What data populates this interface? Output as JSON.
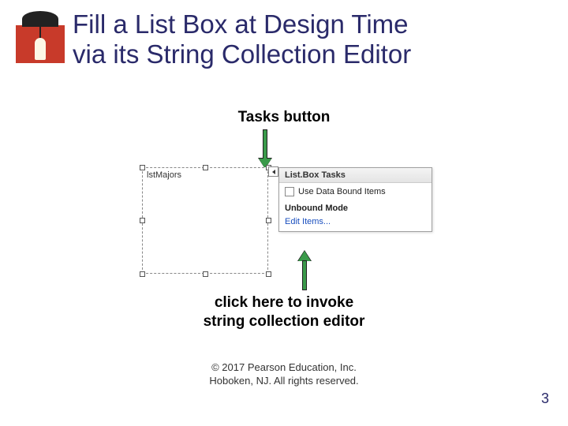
{
  "title_line1": "Fill a List Box at Design Time",
  "title_line2": "via its String Collection Editor",
  "annotation_top": "Tasks button",
  "listbox_name": "lstMajors",
  "tasks_panel": {
    "title": "List.Box Tasks",
    "checkbox_label": "Use Data Bound Items",
    "section": "Unbound Mode",
    "link": "Edit Items..."
  },
  "annotation_bottom_line1": "click here to invoke",
  "annotation_bottom_line2": "string collection editor",
  "copyright_line1": "© 2017 Pearson Education, Inc.",
  "copyright_line2": "Hoboken, NJ. All rights reserved.",
  "page_number": "3"
}
